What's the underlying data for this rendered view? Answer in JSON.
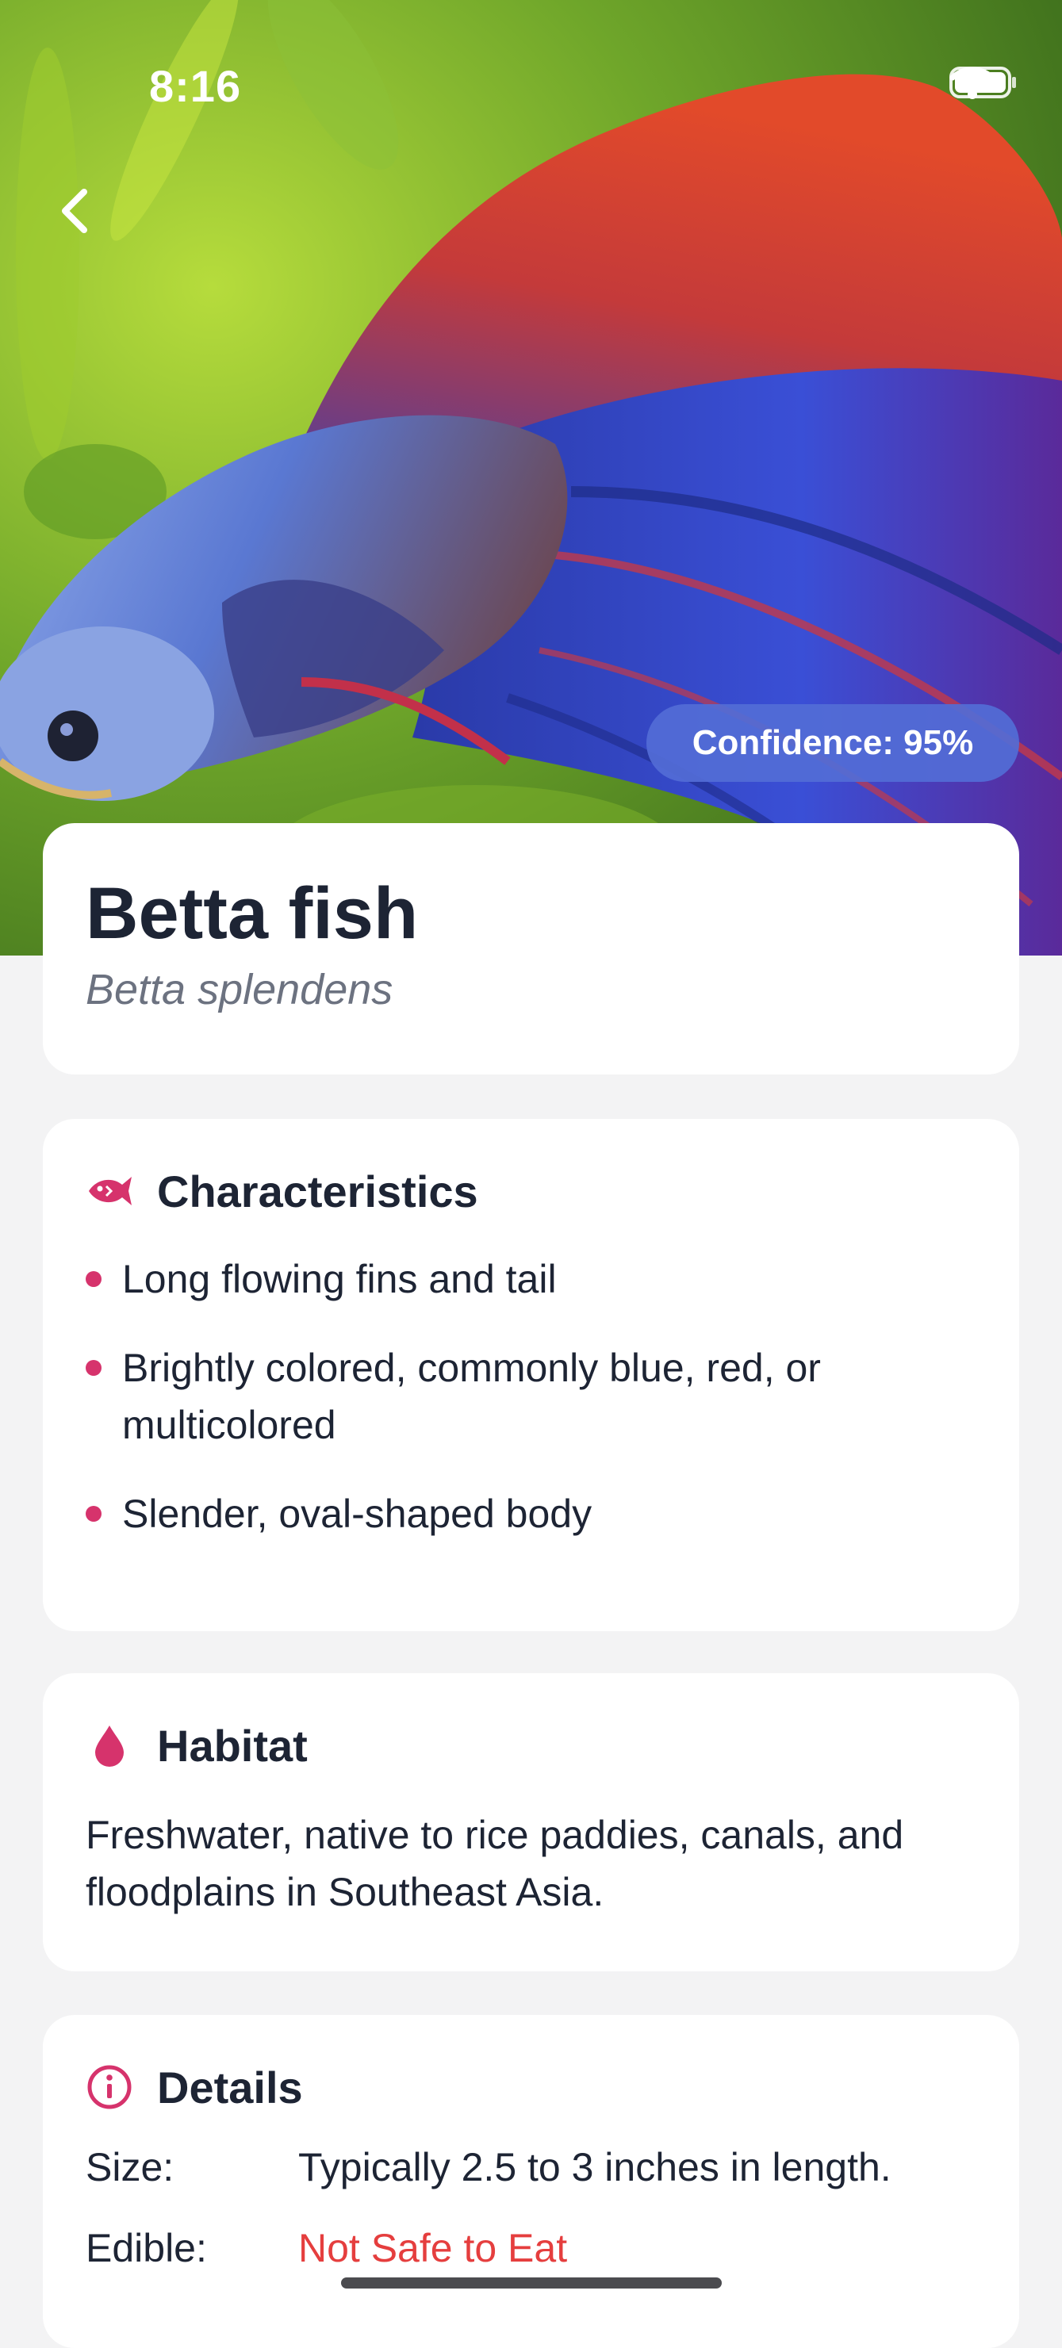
{
  "status_bar": {
    "time": "8:16"
  },
  "hero": {
    "confidence_label": "Confidence: 95%"
  },
  "species": {
    "common_name": "Betta fish",
    "scientific_name": "Betta splendens"
  },
  "characteristics": {
    "title": "Characteristics",
    "items": [
      "Long flowing fins and tail",
      "Brightly colored, commonly blue, red, or multicolored",
      "Slender, oval-shaped body"
    ]
  },
  "habitat": {
    "title": "Habitat",
    "text": "Freshwater, native to rice paddies, canals, and floodplains in Southeast Asia."
  },
  "details": {
    "title": "Details",
    "rows": [
      {
        "label": "Size:",
        "value": "Typically 2.5 to 3 inches in length."
      },
      {
        "label": "Edible:",
        "value": "Not Safe to Eat"
      }
    ]
  },
  "icons": {
    "back": "chevron-left-icon",
    "characteristics": "fish-icon",
    "habitat": "water-drop-icon",
    "details": "info-icon",
    "wifi": "wifi-icon",
    "battery": "battery-icon"
  },
  "colors": {
    "accent_pink": "#d6336c",
    "badge_blue": "#526cd6",
    "unsafe_red": "#e53e3e",
    "text_dark": "#1d2434",
    "text_muted": "#6c7280",
    "background": "#f3f3f4"
  }
}
